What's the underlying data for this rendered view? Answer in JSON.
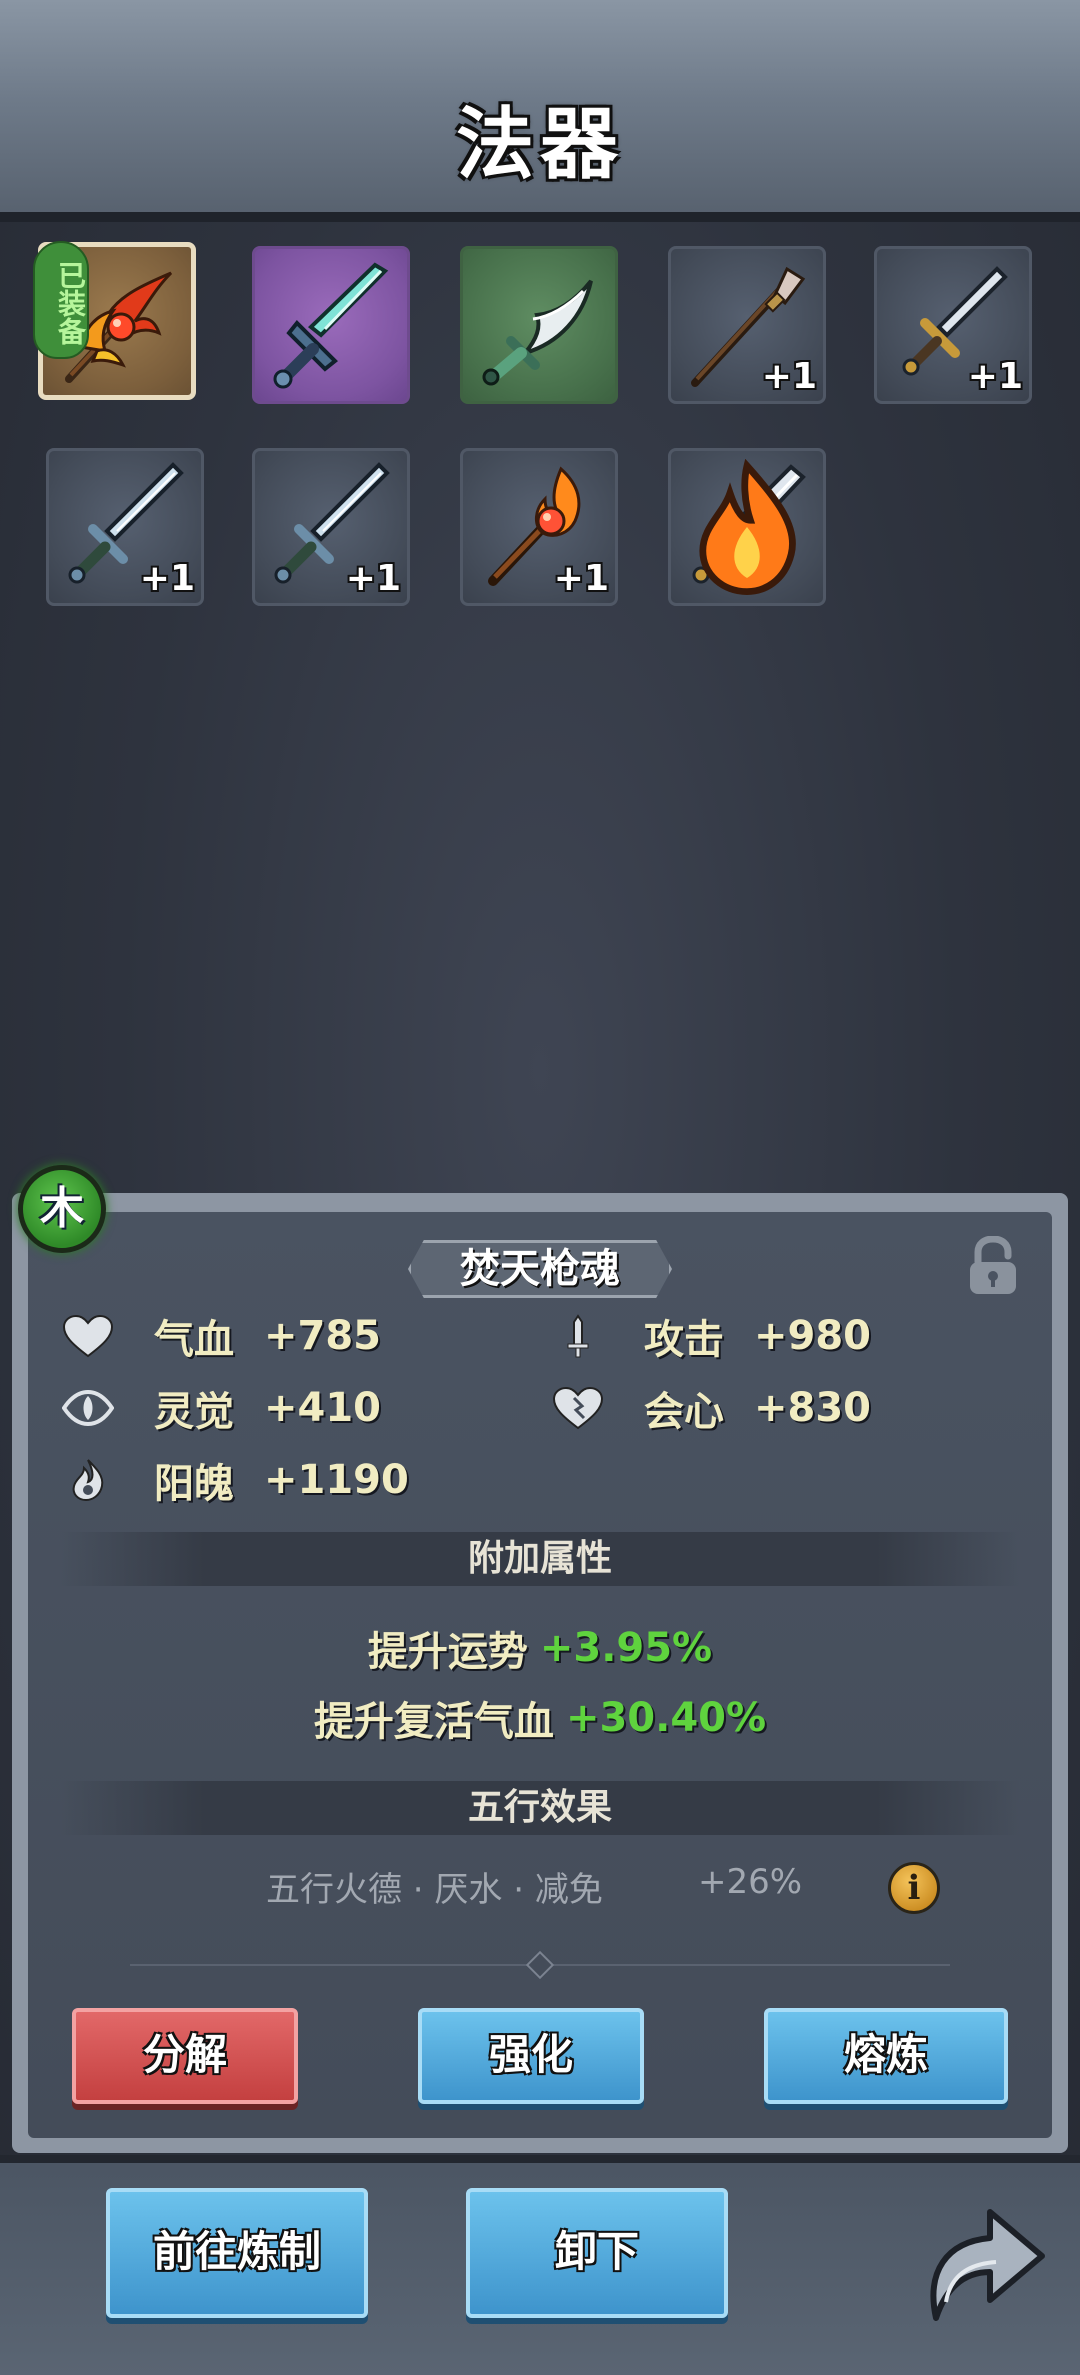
{
  "title": "法器",
  "items": [
    {
      "name": "equipped-spear",
      "tag": "已装备",
      "plus": "",
      "fire": false
    },
    {
      "name": "purple-sword",
      "plus": "",
      "fire": false
    },
    {
      "name": "green-saber",
      "plus": "",
      "fire": false
    },
    {
      "name": "spear",
      "plus": "+1",
      "fire": false
    },
    {
      "name": "short-sword",
      "plus": "+1",
      "fire": false
    },
    {
      "name": "sword",
      "plus": "+1",
      "fire": false
    },
    {
      "name": "sword-2",
      "plus": "+1",
      "fire": false
    },
    {
      "name": "fire-staff",
      "plus": "+1",
      "fire": false
    },
    {
      "name": "broad-sword",
      "plus": "",
      "fire": true
    }
  ],
  "detail": {
    "element": "木",
    "name": "焚天枪魂",
    "stats": [
      {
        "label": "气血",
        "value": "+785",
        "icon": "heart-icon"
      },
      {
        "label": "攻击",
        "value": "+980",
        "icon": "sword-icon"
      },
      {
        "label": "灵觉",
        "value": "+410",
        "icon": "spirit-eye-icon"
      },
      {
        "label": "会心",
        "value": "+830",
        "icon": "critical-heart-icon"
      },
      {
        "label": "阳魄",
        "value": "+1190",
        "icon": "soul-flame-icon"
      }
    ],
    "extra_title": "附加属性",
    "extras": [
      {
        "label": "提升运势",
        "value": "+3.95%"
      },
      {
        "label": "提升复活气血",
        "value": "+30.40%"
      }
    ],
    "wuxing_title": "五行效果",
    "wuxing_effect": "五行火德 · 厌水 · 减免",
    "wuxing_value": "+26%",
    "info_glyph": "i"
  },
  "buttons": {
    "decompose": "分解",
    "enhance": "强化",
    "smelt": "熔炼",
    "go_refine": "前往炼制",
    "unequip": "卸下"
  },
  "colors": {
    "accent_green": "#5fd33e",
    "stat_text": "#f1ecc2",
    "red_button": "#c44040",
    "blue_button": "#3e94cc"
  }
}
